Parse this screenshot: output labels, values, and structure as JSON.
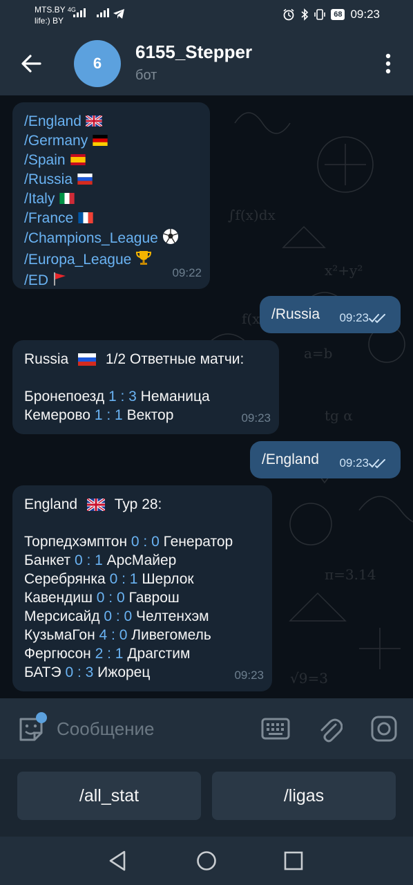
{
  "status_bar": {
    "carrier1": "MTS.BY",
    "net1": "4G",
    "carrier2": "life:) BY",
    "battery": "68",
    "time": "09:23"
  },
  "header": {
    "avatar_letter": "6",
    "title": "6155_Stepper",
    "subtitle": "бот",
    "avatar_color": "#5ca1de"
  },
  "messages": {
    "m1": {
      "lines": [
        {
          "cmd": "/England",
          "emoji": "flag-gb"
        },
        {
          "cmd": "/Germany",
          "emoji": "flag-de"
        },
        {
          "cmd": "/Spain",
          "emoji": "flag-es"
        },
        {
          "cmd": "/Russia",
          "emoji": "flag-ru"
        },
        {
          "cmd": "/Italy",
          "emoji": "flag-it"
        },
        {
          "cmd": "/France",
          "emoji": "flag-fr"
        },
        {
          "cmd": "/Champions_League",
          "emoji": "soccer-ball"
        },
        {
          "cmd": "/Europa_League",
          "emoji": "trophy"
        },
        {
          "cmd": "/ED",
          "emoji": "red-flag"
        }
      ],
      "time": "09:22"
    },
    "m2": {
      "text": "/Russia",
      "time": "09:23"
    },
    "m3": {
      "country": "Russia",
      "round": "1/2 Ответные матчи:",
      "matches": [
        {
          "home": "Бронепоезд",
          "score": "1 : 3",
          "away": "Неманица"
        },
        {
          "home": "Кемерово",
          "score": "1 : 1",
          "away": "Вектор"
        }
      ],
      "time": "09:23"
    },
    "m4": {
      "text": "/England",
      "time": "09:23"
    },
    "m5": {
      "country": "England",
      "round": "Тур 28:",
      "matches": [
        {
          "home": "Торпедхэмптон",
          "score": "0 : 0",
          "away": "Генератор"
        },
        {
          "home": "Банкет",
          "score": "0 : 1",
          "away": "АрсМайер"
        },
        {
          "home": "Серебрянка",
          "score": "0 : 1",
          "away": "Шерлок"
        },
        {
          "home": "Кавендиш",
          "score": "0 : 0",
          "away": "Гаврош"
        },
        {
          "home": "Мерсисайд",
          "score": "0 : 0",
          "away": "Челтенхэм"
        },
        {
          "home": "КузьмаГон",
          "score": "4 : 0",
          "away": "Ливегомель"
        },
        {
          "home": "Фергюсон",
          "score": "2 : 1",
          "away": "Драгстим"
        },
        {
          "home": "БАТЭ",
          "score": "0 : 3",
          "away": "Ижорец"
        }
      ],
      "time": "09:23"
    }
  },
  "composer": {
    "placeholder": "Сообщение"
  },
  "bot_keyboard": {
    "key1": "/all_stat",
    "key2": "/ligas"
  },
  "colors": {
    "background": "#0b1118",
    "incoming": "#182533",
    "outgoing": "#2b5278",
    "link": "#6ab3f3"
  }
}
